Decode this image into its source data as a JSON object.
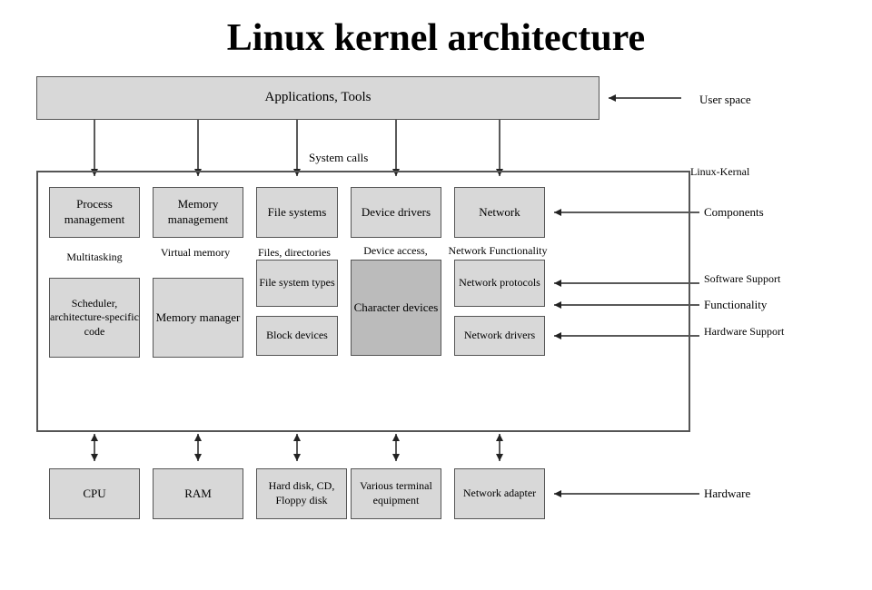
{
  "title": "Linux kernel architecture",
  "boxes": {
    "applications": "Applications, Tools",
    "process_management": "Process management",
    "memory_management": "Memory management",
    "file_systems": "File systems",
    "device_drivers": "Device drivers",
    "network": "Network",
    "scheduler": "Scheduler, architecture-specific code",
    "memory_manager": "Memory manager",
    "fs_types": "File system types",
    "block_devices": "Block devices",
    "character_devices": "Character devices",
    "network_protocols": "Network protocols",
    "network_drivers": "Network drivers",
    "cpu": "CPU",
    "ram": "RAM",
    "hdd": "Hard disk, CD, Floppy disk",
    "terminal": "Various terminal equipment",
    "network_adapter": "Network adapter"
  },
  "labels": {
    "user_space": "User space",
    "linux_kernal": "Linux-Kernal",
    "system_calls": "System calls",
    "components": "Components",
    "functionality": "Functionality",
    "multitasking": "Multitasking",
    "virtual_memory": "Virtual memory",
    "files_directories": "Files, directories",
    "device_access": "Device access, terminals",
    "network_functionality": "Network Functionality",
    "software_support": "Software Support",
    "hardware_support": "Hardware Support",
    "hardware": "Hardware"
  }
}
